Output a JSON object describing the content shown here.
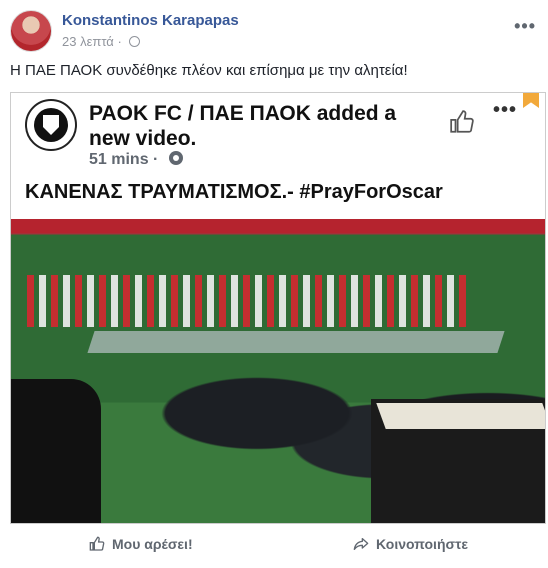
{
  "post": {
    "author": "Konstantinos Karapapas",
    "time": "23 λεπτά",
    "text": "Η ΠΑΕ ΠΑΟΚ συνδέθηκε πλέον και επίσημα με την αλητεία!"
  },
  "shared": {
    "page_name": "PAOK FC / ΠΑΕ ΠΑΟΚ",
    "action_text": "added a new video.",
    "time": "51 mins",
    "caption": "ΚΑΝΕΝΑΣ ΤΡΑΥΜΑΤΙΣΜΟΣ.- #PrayForOscar"
  },
  "actions": {
    "like_label": "Μου αρέσει!",
    "share_label": "Κοινοποιήστε"
  },
  "icons": {
    "more": "more-options-icon",
    "globe": "globe-icon",
    "gear": "gear-icon",
    "like": "thumbs-up-icon",
    "share": "share-arrow-icon",
    "bookmark": "bookmark-icon"
  },
  "colors": {
    "author_link": "#385898",
    "bookmark": "#f2a93b",
    "muted": "#606770"
  }
}
